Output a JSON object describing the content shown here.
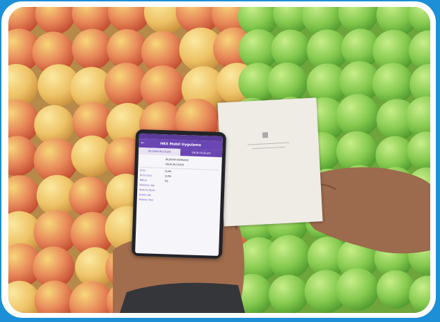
{
  "scene": {
    "subject": "phone-and-receipt-over-apples",
    "border_color": "#1c8fd6",
    "frame_color": "#ffffff",
    "red_apple_color": "#d9543a",
    "yellow_apple_color": "#f0c060",
    "green_apple_color": "#7cc24a"
  },
  "phone": {
    "app_title": "HKS Mobil Uygulama",
    "tabs": [
      "BİLDİRİM BİLGİLERİ",
      "ÜRÜN BİLGİLERİ"
    ],
    "rows": [
      {
        "key": "",
        "value": "BİLDİRİM NUMARASI"
      },
      {
        "key": "",
        "value": "ÜRÜN BİLGİLERİ"
      },
      {
        "key": "Ürün",
        "value": "ELMA"
      },
      {
        "key": "Ürün Cinsi",
        "value": "ELMA"
      },
      {
        "key": "Miktar",
        "value": "KG"
      },
      {
        "key": "Bildirimci Adı",
        "value": ""
      },
      {
        "key": "Bildirim Tarihi",
        "value": ""
      },
      {
        "key": "Üretici Adı",
        "value": ""
      },
      {
        "key": "Bildirim Türü",
        "value": ""
      }
    ]
  },
  "receipt": {
    "icon": "qr-code-icon"
  }
}
